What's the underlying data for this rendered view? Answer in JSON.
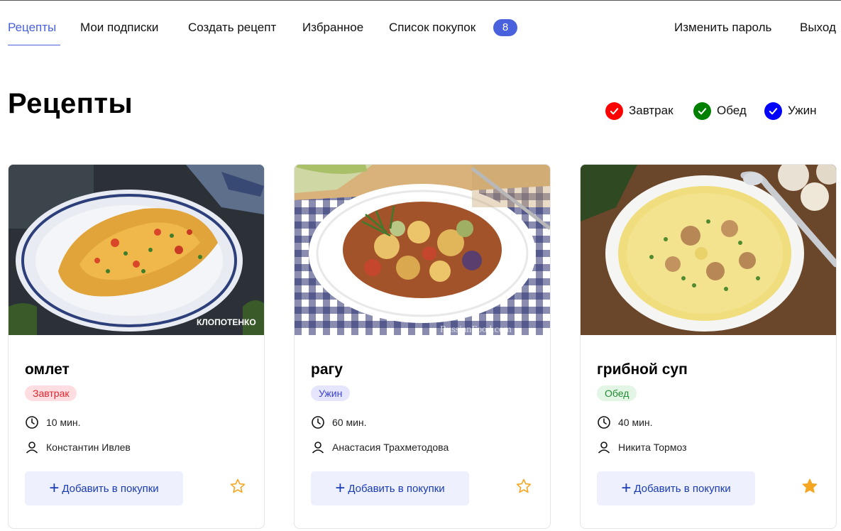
{
  "nav": {
    "items": [
      {
        "label": "Рецепты",
        "active": true
      },
      {
        "label": "Мои подписки"
      },
      {
        "label": "Создать рецепт"
      },
      {
        "label": "Избранное"
      },
      {
        "label": "Список покупок"
      }
    ],
    "cart_count": "8",
    "change_password": "Изменить пароль",
    "logout": "Выход"
  },
  "page": {
    "title": "Рецепты"
  },
  "filters": [
    {
      "label": "Завтрак",
      "color": "#ff0000",
      "checked": true
    },
    {
      "label": "Обед",
      "color": "#008000",
      "checked": true
    },
    {
      "label": "Ужин",
      "color": "#0000ff",
      "checked": true
    }
  ],
  "recipes": [
    {
      "title": "омлет",
      "tag": "Завтрак",
      "tag_bg": "#ffdde0",
      "tag_color": "#e0262e",
      "time": "10 мин.",
      "author": "Константин Ивлев",
      "add_label": "Добавить в покупки",
      "favorite": false,
      "watermark": "КЛОПОТЕНКО"
    },
    {
      "title": "рагу",
      "tag": "Ужин",
      "tag_bg": "#e5e6fd",
      "tag_color": "#3a3fd1",
      "time": "60 мин.",
      "author": "Анастасия Трахметодова",
      "add_label": "Добавить в покупки",
      "favorite": false,
      "watermark": "RussianFood.com"
    },
    {
      "title": "грибной суп",
      "tag": "Обед",
      "tag_bg": "#e3f6e5",
      "tag_color": "#1f8a30",
      "time": "40 мин.",
      "author": "Никита Тормоз",
      "add_label": "Добавить в покупки",
      "favorite": true
    }
  ],
  "colors": {
    "accent": "#4a61dd",
    "star": "#f5a623",
    "button_bg": "#eef1fd",
    "button_text": "#1a3bb3"
  }
}
